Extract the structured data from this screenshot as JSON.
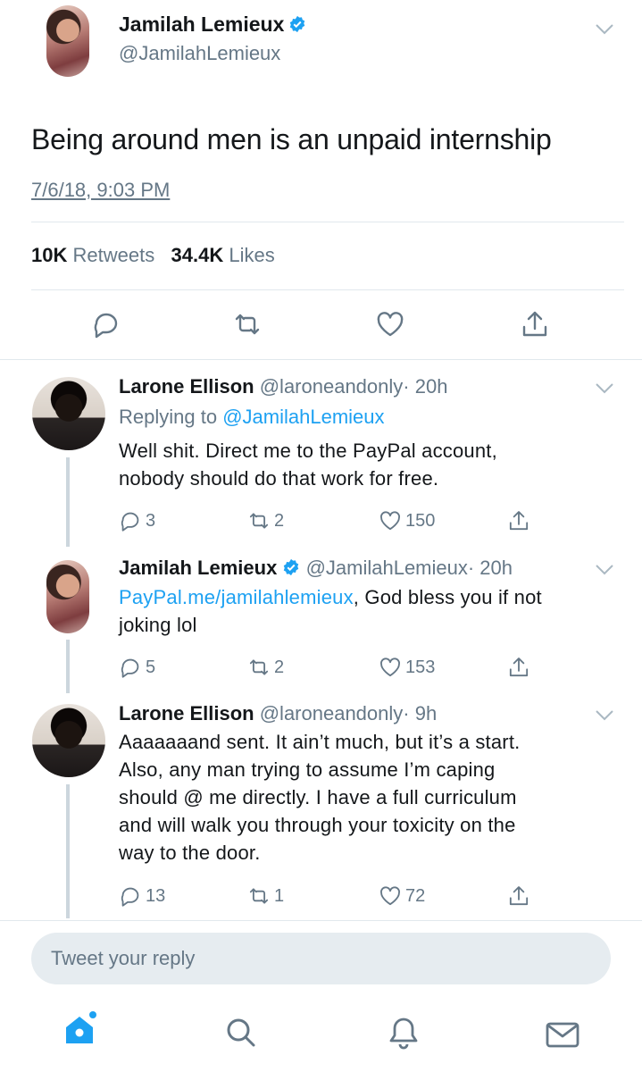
{
  "main_tweet": {
    "author_name": "Jamilah Lemieux",
    "author_handle": "@JamilahLemieux",
    "text": "Being around men is an unpaid internship",
    "timestamp": "7/6/18, 9:03 PM",
    "retweets_count": "10K",
    "retweets_label": "Retweets",
    "likes_count": "34.4K",
    "likes_label": "Likes"
  },
  "replies": [
    {
      "author_name": "Larone Ellison",
      "author_handle": "@laroneandonly",
      "time": "· 20h",
      "replying_prefix": "Replying to",
      "replying_to": "@JamilahLemieux",
      "line1": "Well shit. Direct me to the PayPal account,",
      "line2": "nobody should do that work for free.",
      "reply_count": "3",
      "retweet_count": "2",
      "like_count": "150"
    },
    {
      "author_name": "Jamilah Lemieux",
      "author_handle": "@JamilahLemieux",
      "time": "· 20h",
      "link_text": "PayPal.me/jamilahlemieux",
      "line1_rest": ", God bless you if not",
      "line2": "joking lol",
      "reply_count": "5",
      "retweet_count": "2",
      "like_count": "153"
    },
    {
      "author_name": "Larone Ellison",
      "author_handle": "@laroneandonly",
      "time": "· 9h",
      "line1": "Aaaaaaand sent. It ain’t much, but it’s a start.",
      "line2": "Also, any man trying to assume I’m caping",
      "line3": "should @ me directly. I have a full curriculum",
      "line4": "and will walk you through your toxicity on the",
      "line5": "way to the door.",
      "reply_count": "13",
      "retweet_count": "1",
      "like_count": "72"
    }
  ],
  "reply_box": {
    "placeholder": "Tweet your reply"
  },
  "colors": {
    "accent": "#1da1f2",
    "muted": "#657786",
    "divider": "#e1e8ed",
    "thread_line": "#ccd6dd"
  },
  "icons": [
    "verified-badge-icon",
    "chevron-down-icon",
    "reply-icon",
    "retweet-icon",
    "like-icon",
    "share-icon",
    "home-icon",
    "search-icon",
    "notifications-icon",
    "messages-icon"
  ]
}
